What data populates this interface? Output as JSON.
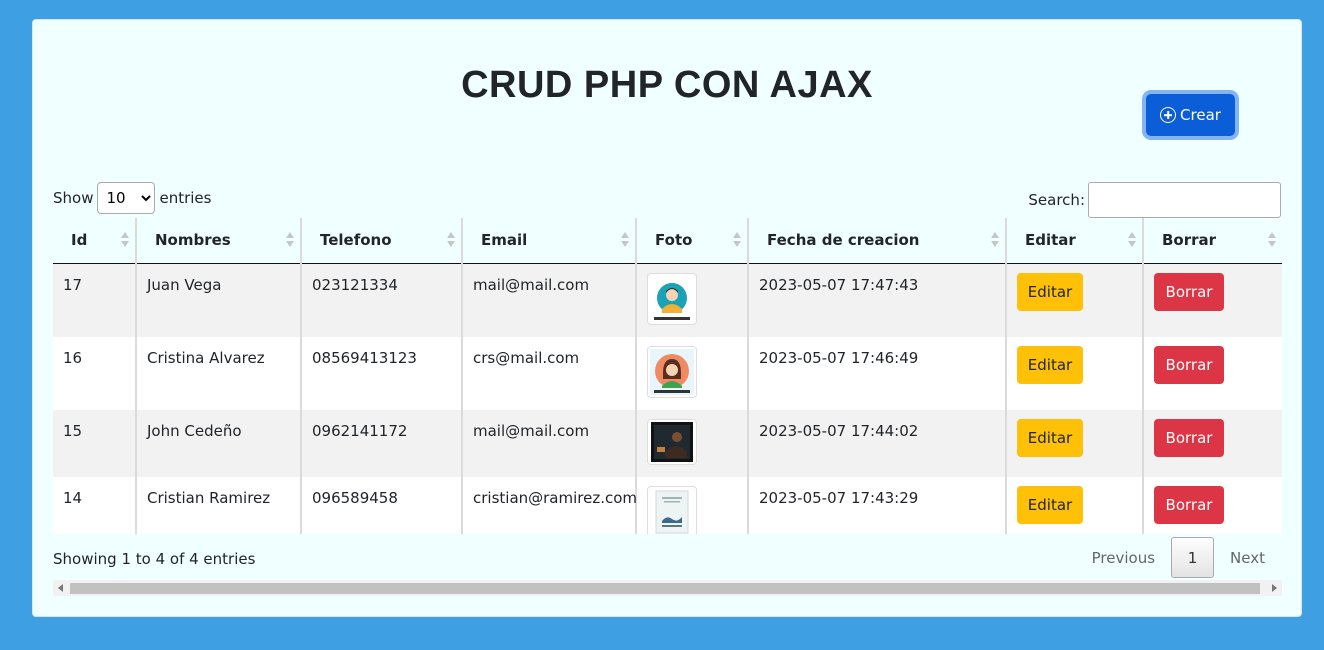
{
  "page": {
    "title": "CRUD PHP CON AJAX"
  },
  "create_button": {
    "label": "Crear",
    "icon": "plus-circle-icon",
    "color": "#0b5ed7"
  },
  "length_control": {
    "prefix": "Show",
    "selected": "10",
    "suffix": "entries"
  },
  "search": {
    "label": "Search:",
    "value": ""
  },
  "table": {
    "headers": [
      "Id",
      "Nombres",
      "Telefono",
      "Email",
      "Foto",
      "Fecha de creacion",
      "Editar",
      "Borrar"
    ],
    "rows": [
      {
        "id": "17",
        "nombres": "Juan Vega",
        "telefono": "023121334",
        "email": "mail@mail.com",
        "foto": "avatar-man-icon",
        "fecha": "2023-05-07 17:47:43",
        "editar": "Editar",
        "borrar": "Borrar"
      },
      {
        "id": "16",
        "nombres": "Cristina Alvarez",
        "telefono": "08569413123",
        "email": "crs@mail.com",
        "foto": "avatar-woman-icon",
        "fecha": "2023-05-07 17:46:49",
        "editar": "Editar",
        "borrar": "Borrar"
      },
      {
        "id": "15",
        "nombres": "John Cedeño",
        "telefono": "0962141172",
        "email": "mail@mail.com",
        "foto": "dark-photo-icon",
        "fecha": "2023-05-07 17:44:02",
        "editar": "Editar",
        "borrar": "Borrar"
      },
      {
        "id": "14",
        "nombres": "Cristian Ramirez",
        "telefono": "096589458",
        "email": "cristian@ramirez.com",
        "foto": "book-cover-icon",
        "fecha": "2023-05-07 17:43:29",
        "editar": "Editar",
        "borrar": "Borrar"
      }
    ]
  },
  "footer": {
    "info": "Showing 1 to 4 of 4 entries",
    "previous": "Previous",
    "current_page": "1",
    "next": "Next"
  },
  "colors": {
    "background": "#3f9fe3",
    "card": "#f0ffff",
    "edit": "#ffc107",
    "delete": "#dc3545"
  }
}
